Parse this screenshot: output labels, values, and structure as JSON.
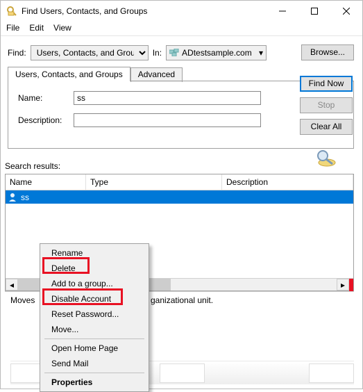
{
  "window": {
    "title": "Find Users, Contacts, and Groups"
  },
  "menubar": {
    "file": "File",
    "edit": "Edit",
    "view": "View"
  },
  "find": {
    "label": "Find:",
    "type_value": "Users, Contacts, and Groups",
    "in_label": "In:",
    "in_value": "ADtestsample.com",
    "browse": "Browse..."
  },
  "tabs": {
    "t1": "Users, Contacts, and Groups",
    "t2": "Advanced"
  },
  "form": {
    "name_label": "Name:",
    "name_value": "ss",
    "desc_label": "Description:",
    "desc_value": ""
  },
  "buttons": {
    "find_now": "Find Now",
    "stop": "Stop",
    "clear_all": "Clear All"
  },
  "results": {
    "label": "Search results:",
    "columns": {
      "name": "Name",
      "type": "Type",
      "desc": "Description"
    },
    "row": {
      "name": "ss",
      "type": "",
      "desc": ""
    }
  },
  "context_menu": {
    "rename": "Rename",
    "delete": "Delete",
    "add_to_group": "Add to a group...",
    "disable": "Disable Account",
    "reset_pw": "Reset Password...",
    "move": "Move...",
    "open_home": "Open Home Page",
    "send_mail": "Send Mail",
    "properties": "Properties"
  },
  "status": {
    "left": "Moves",
    "right": "ganizational unit."
  }
}
